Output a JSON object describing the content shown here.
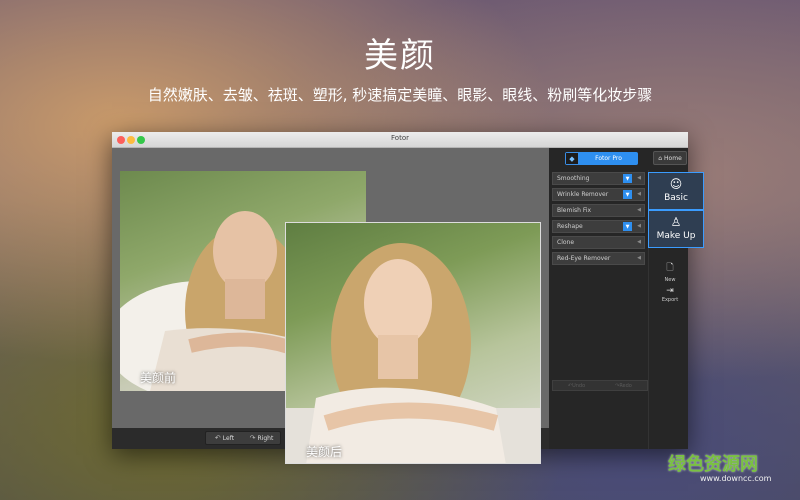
{
  "promo": {
    "title": "美颜",
    "subtitle": "自然嫩肤、去皱、祛斑、塑形, 秒速搞定美瞳、眼影、眼线、粉刷等化妆步骤"
  },
  "window": {
    "title": "Fotor"
  },
  "toolbar": {
    "pro_label": "Fotor Pro",
    "home_label": "Home"
  },
  "tools": [
    {
      "label": "Smoothing",
      "badge": true
    },
    {
      "label": "Wrinkle Remover",
      "badge": true
    },
    {
      "label": "Blemish Fix",
      "badge": false
    },
    {
      "label": "Reshape",
      "badge": true
    },
    {
      "label": "Clone",
      "badge": false
    },
    {
      "label": "Red-Eye Remover",
      "badge": false
    }
  ],
  "modes": {
    "basic": "Basic",
    "makeup": "Make Up"
  },
  "side_actions": {
    "new": "New",
    "export": "Export"
  },
  "history": {
    "undo": "Undo",
    "redo": "Redo"
  },
  "rotate": {
    "left": "Left",
    "right": "Right"
  },
  "photos": {
    "before_label": "美颜前",
    "after_label": "美颜后"
  },
  "watermark": {
    "logo": "绿色资源网",
    "url": "www.downcc.com"
  },
  "colors": {
    "accent": "#2e8ff0",
    "mode_border": "#3b9cff",
    "panel_bg": "#262626",
    "canvas_bg": "#696969"
  }
}
